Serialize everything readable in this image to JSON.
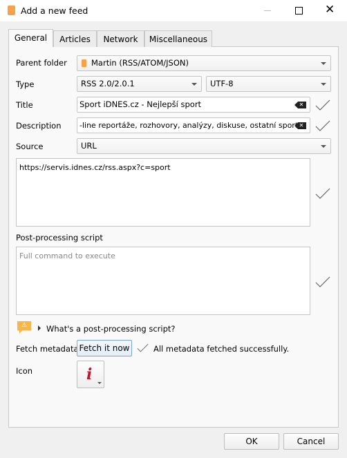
{
  "window": {
    "title": "Add a new feed",
    "icon": "rss-icon",
    "controls": [
      "minimize",
      "maximize",
      "close"
    ]
  },
  "tabs": [
    {
      "label": "General",
      "active": true
    },
    {
      "label": "Articles"
    },
    {
      "label": "Network"
    },
    {
      "label": "Miscellaneous"
    }
  ],
  "form": {
    "parent_folder": {
      "label": "Parent folder",
      "value": "Martin (RSS/ATOM/JSON)"
    },
    "type": {
      "label": "Type",
      "value": "RSS 2.0/2.0.1",
      "encoding": "UTF-8"
    },
    "title": {
      "label": "Title",
      "value": "Sport iDNES.cz - Nejlepší sport"
    },
    "description": {
      "label": "Description",
      "value": "-line reportáže, rozhovory, analýzy, diskuse, ostatní sporty."
    },
    "source": {
      "label": "Source",
      "value": "URL",
      "url": "https://servis.idnes.cz/rss.aspx?c=sport"
    },
    "post_processing": {
      "label": "Post-processing script",
      "placeholder": "Full command to execute",
      "hint": "What's a post-processing script?"
    },
    "fetch": {
      "label": "Fetch metadata",
      "button": "Fetch it now",
      "status": "All metadata fetched successfully."
    },
    "icon": {
      "label": "Icon",
      "glyph": "i",
      "color": "#c8102e"
    }
  },
  "buttons": {
    "ok": "OK",
    "cancel": "Cancel"
  },
  "colors": {
    "accent": "#f39c3c",
    "icon_red": "#c8102e"
  }
}
